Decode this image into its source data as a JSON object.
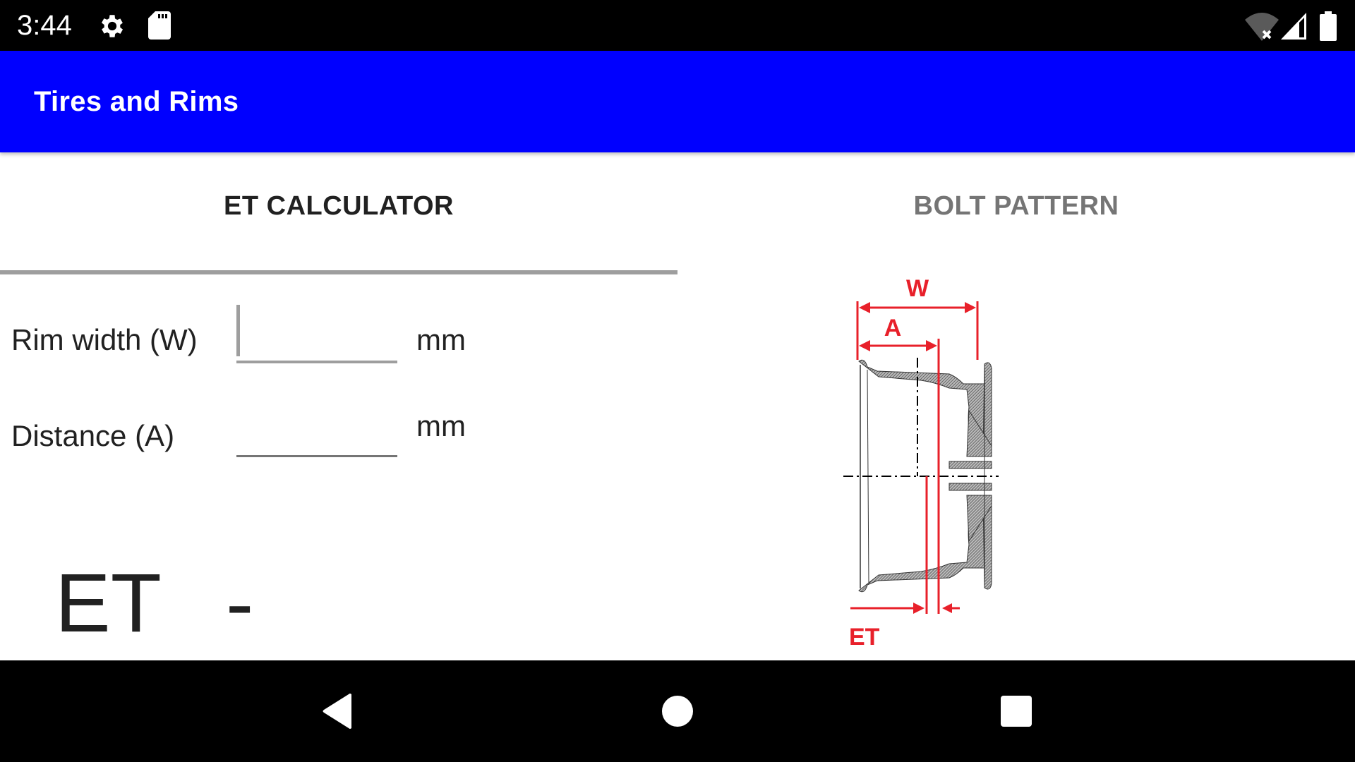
{
  "status_bar": {
    "time": "3:44",
    "left_icons": [
      "settings-icon",
      "sd-card-icon"
    ],
    "right_icons": [
      "wifi-off-icon",
      "cell-signal-icon",
      "battery-icon"
    ]
  },
  "app_bar": {
    "title": "Tires and Rims",
    "color": "#0000FF"
  },
  "tabs": [
    {
      "label": "ET CALCULATOR",
      "selected": true
    },
    {
      "label": "BOLT PATTERN",
      "selected": false
    }
  ],
  "form": {
    "rim_width": {
      "label": "Rim width (W)",
      "value": "",
      "unit": "mm"
    },
    "distance": {
      "label": "Distance (A)",
      "value": "",
      "unit": "mm"
    }
  },
  "result": {
    "label": "ET",
    "value": "-"
  },
  "diagram": {
    "labels": {
      "width": "W",
      "distance": "A",
      "offset": "ET"
    },
    "accent_color": "#E8202A"
  },
  "nav_bar": {
    "buttons": [
      "back",
      "home",
      "recents"
    ]
  }
}
